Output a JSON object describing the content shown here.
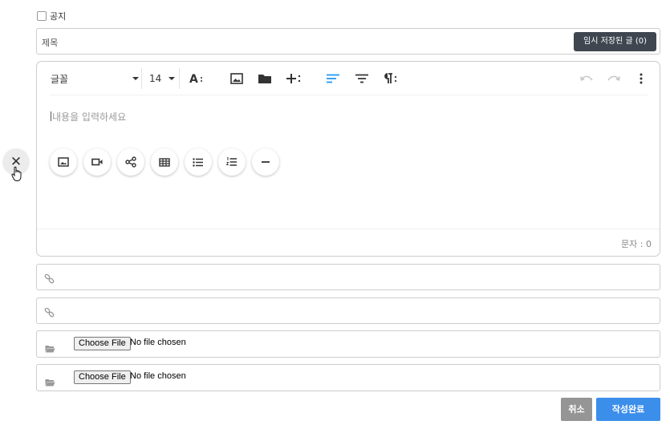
{
  "notice": {
    "label": "공지"
  },
  "title": {
    "placeholder": "제목",
    "draft_button": "임시 저장된 글 (0)"
  },
  "editor": {
    "toolbar": {
      "font": "글꼴",
      "size": "14",
      "icons": [
        "text-style-icon",
        "image-icon",
        "folder-icon",
        "insert-more-icon",
        "align-left-icon",
        "align-center-icon",
        "paragraph-icon",
        "undo-icon",
        "redo-icon",
        "more-options-icon"
      ]
    },
    "placeholder": "내용을 입력하세요",
    "quick_insert": [
      "image-icon",
      "video-icon",
      "share-icon",
      "table-icon",
      "bullet-list-icon",
      "numbered-list-icon",
      "divider-icon"
    ],
    "counter": "문자 : 0"
  },
  "links": [
    {
      "icon": "link-icon"
    },
    {
      "icon": "link-icon"
    }
  ],
  "files": [
    {
      "button": "Choose File",
      "status": "No file chosen"
    },
    {
      "button": "Choose File",
      "status": "No file chosen"
    }
  ],
  "actions": {
    "cancel": "취소",
    "submit": "작성완료"
  },
  "colors": {
    "accent": "#3b8eea",
    "dark_button": "#3f4650",
    "cancel_button": "#959595",
    "active_align": "#2196f3"
  }
}
